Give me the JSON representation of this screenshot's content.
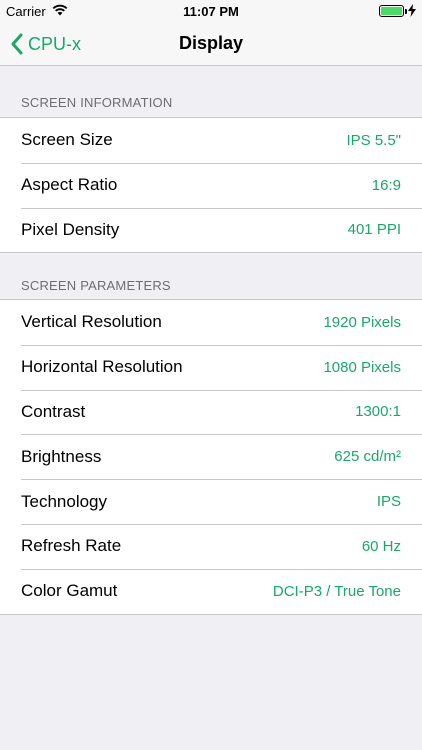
{
  "status_bar": {
    "carrier": "Carrier",
    "time": "11:07 PM",
    "battery_level": 1.0,
    "battery_color": "#4cd964"
  },
  "nav": {
    "back_label": "CPU-x",
    "title": "Display",
    "back_icon": "chevron-left-icon"
  },
  "sections": {
    "screen_information": {
      "header": "SCREEN INFORMATION",
      "rows": [
        {
          "label": "Screen Size",
          "value": "IPS 5.5\""
        },
        {
          "label": "Aspect Ratio",
          "value": "16:9"
        },
        {
          "label": "Pixel Density",
          "value": "401 PPI"
        }
      ]
    },
    "screen_parameters": {
      "header": "SCREEN PARAMETERS",
      "rows": [
        {
          "label": "Vertical Resolution",
          "value": "1920 Pixels"
        },
        {
          "label": "Horizontal Resolution",
          "value": "1080 Pixels"
        },
        {
          "label": "Contrast",
          "value": "1300:1"
        },
        {
          "label": "Brightness",
          "value": "625 cd/m²"
        },
        {
          "label": "Technology",
          "value": "IPS"
        },
        {
          "label": "Refresh Rate",
          "value": "60 Hz"
        },
        {
          "label": "Color Gamut",
          "value": "DCI-P3 / True Tone"
        }
      ]
    }
  },
  "colors": {
    "accent": "#1aa76a",
    "background": "#efeff4",
    "section_header": "#6d6d72"
  }
}
